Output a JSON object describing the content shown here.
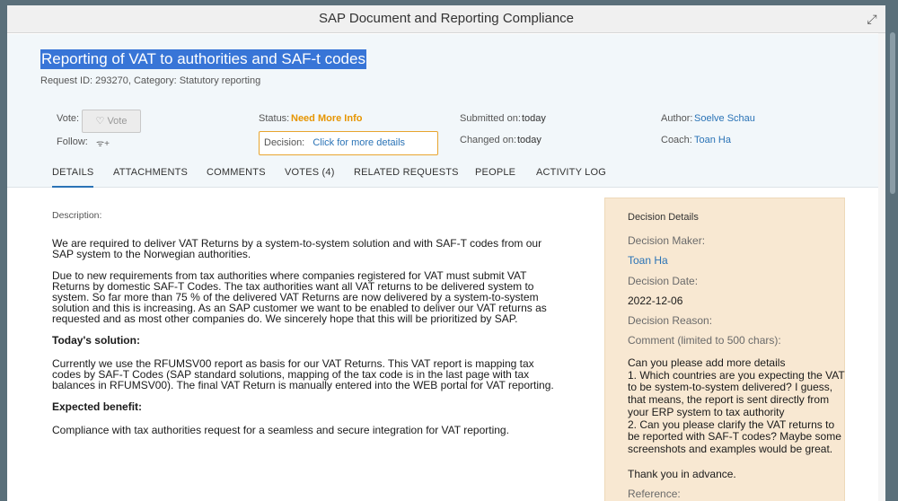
{
  "window": {
    "title": "SAP Document and Reporting Compliance"
  },
  "request": {
    "title": "Reporting of VAT to authorities and SAF-t codes",
    "meta": "Request ID: 293270, Category: Statutory reporting"
  },
  "header": {
    "vote_label": "Vote:",
    "vote_button": "Vote",
    "follow_label": "Follow:",
    "status_label": "Status:",
    "status_value": "Need More Info",
    "decision_label": "Decision:",
    "decision_link": "Click for more details",
    "submitted_label": "Submitted on:",
    "submitted_value": "today",
    "changed_label": "Changed on:",
    "changed_value": "today",
    "author_label": "Author:",
    "author_value": "Soelve Schau",
    "coach_label": "Coach:",
    "coach_value": "Toan Ha"
  },
  "tabs": [
    "DETAILS",
    "ATTACHMENTS",
    "COMMENTS",
    "VOTES (4)",
    "RELATED REQUESTS",
    "PEOPLE",
    "ACTIVITY LOG"
  ],
  "description": {
    "label": "Description:",
    "p1": "We are required to deliver VAT Returns by a system-to-system solution and with SAF-T codes from our SAP system to the Norwegian authorities.",
    "p2": "Due to new requirements from tax authorities where companies registered for VAT must submit VAT Returns by domestic SAF-T Codes. The tax authorities want all VAT returns to be delivered system to system.  So far more than 75 % of the delivered VAT Returns are now delivered by a system-to-system solution and this is increasing.  As an SAP customer we want to be enabled to deliver our VAT returns as requested and as most other companies do. We sincerely hope that this will be prioritized by SAP.",
    "h_solution": "Today's solution:",
    "p3": "Currently we use the RFUMSV00 report as basis for our VAT Returns. This VAT report is mapping tax codes by SAF-T Codes (SAP standard solutions, mapping of the tax code is in the last page with tax balances in RFUMSV00). The final VAT Return is manually entered into the WEB portal for VAT reporting.",
    "h_benefit": "Expected benefit:",
    "p4": "Compliance with tax authorities request for a seamless and secure integration for VAT reporting."
  },
  "decision": {
    "title": "Decision Details",
    "maker_label": "Decision Maker:",
    "maker_value": "Toan Ha",
    "date_label": "Decision Date:",
    "date_value": "2022-12-06",
    "reason_label": "Decision Reason:",
    "comment_label": "Comment (limited to 500 chars):",
    "comment_l1": "Can you please add more details",
    "comment_l2": "1. Which countries are you expecting the VAT to be system-to-system delivered? I guess, that means, the report is sent directly from your ERP system to tax authority",
    "comment_l3": "2. Can you please clarify the VAT returns to be reported with SAF-T codes? Maybe some screenshots and examples would be great.",
    "thanks": "Thank you in advance.",
    "reference_label": "Reference:"
  },
  "colors": {
    "accent": "#2a73b6",
    "status": "#e69500",
    "decision_panel": "#f8e8d2"
  }
}
